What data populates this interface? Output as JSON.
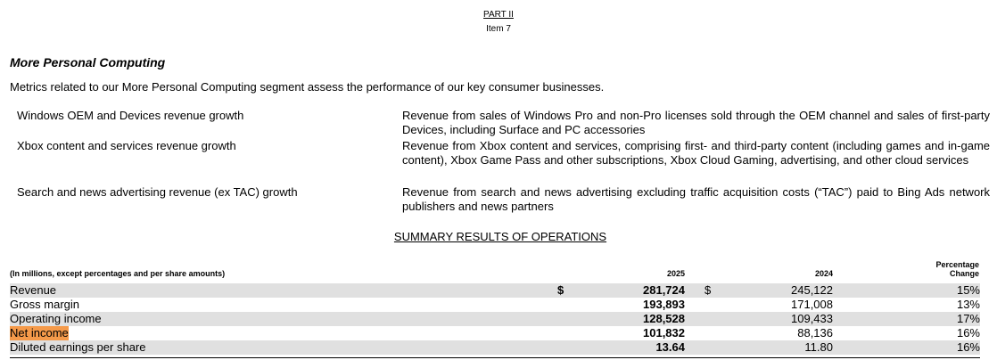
{
  "header": {
    "part": "PART II",
    "item": "Item 7"
  },
  "section": {
    "title": "More Personal Computing",
    "intro": "Metrics related to our More Personal Computing segment assess the performance of our key consumer businesses."
  },
  "metrics": [
    {
      "name": "Windows OEM and Devices revenue growth",
      "description": "Revenue from sales of Windows Pro and non-Pro licenses sold through the OEM channel and sales of first-party Devices, including Surface and PC accessories"
    },
    {
      "name": "Xbox content and services revenue growth",
      "description": "Revenue from Xbox content and services, comprising first- and third-party content (including games and in-game content), Xbox Game Pass and other subscriptions, Xbox Cloud Gaming, advertising, and other cloud services"
    },
    {
      "name": "Search and news advertising revenue (ex TAC) growth",
      "description": "Revenue from search and news advertising excluding traffic acquisition costs (“TAC”) paid to Bing Ads network publishers and news partners"
    }
  ],
  "summary": {
    "title": "SUMMARY RESULTS OF OPERATIONS",
    "columns": {
      "label": "(In millions, except percentages and per share amounts)",
      "year1": "2025",
      "year2": "2024",
      "change_line1": "Percentage",
      "change_line2": "Change"
    },
    "rows": [
      {
        "label": "Revenue",
        "cur1": "$",
        "v2025": "281,724",
        "cur2": "$",
        "v2024": "245,122",
        "change": "15%"
      },
      {
        "label": "Gross margin",
        "cur1": "",
        "v2025": "193,893",
        "cur2": "",
        "v2024": "171,008",
        "change": "13%"
      },
      {
        "label": "Operating income",
        "cur1": "",
        "v2025": "128,528",
        "cur2": "",
        "v2024": "109,433",
        "change": "17%"
      },
      {
        "label": "Net income",
        "cur1": "",
        "v2025": "101,832",
        "cur2": "",
        "v2024": "88,136",
        "change": "16%"
      },
      {
        "label": "Diluted earnings per share",
        "cur1": "",
        "v2025": "13.64",
        "cur2": "",
        "v2024": "11.80",
        "change": "16%"
      }
    ]
  },
  "colors": {
    "row_shade": "#e0e0e0",
    "highlight": "#f59a4a"
  }
}
